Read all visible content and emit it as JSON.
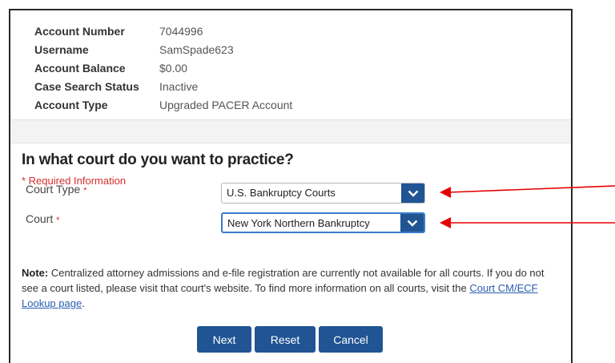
{
  "account": {
    "rows": [
      {
        "label": "Account Number",
        "value": "7044996"
      },
      {
        "label": "Username",
        "value": "SamSpade623"
      },
      {
        "label": "Account Balance",
        "value": "$0.00"
      },
      {
        "label": "Case Search Status",
        "value": "Inactive"
      },
      {
        "label": "Account Type",
        "value": "Upgraded PACER Account"
      }
    ]
  },
  "form": {
    "heading": "In what court do you want to practice?",
    "required_note": "* Required Information",
    "court_type": {
      "label": "Court Type",
      "required_mark": "*",
      "selected": "U.S. Bankruptcy Courts"
    },
    "court": {
      "label": "Court",
      "required_mark": "*",
      "selected": "New York Northern Bankruptcy"
    }
  },
  "note": {
    "lead": "Note:",
    "text": " Centralized attorney admissions and e-file registration are currently not available for all courts. If you do not see a court listed, please visit that court's website. To find more information on all courts, visit the ",
    "link": "Court CM/ECF Lookup page",
    "tail": "."
  },
  "buttons": {
    "next": "Next",
    "reset": "Reset",
    "cancel": "Cancel"
  },
  "colors": {
    "button": "#205493",
    "required": "#d32f2f",
    "annotation_arrow": "#e60000",
    "link": "#2a5db0"
  },
  "icons": {
    "dropdown": "chevron-down-icon",
    "annotation": "arrow-left-icon"
  }
}
